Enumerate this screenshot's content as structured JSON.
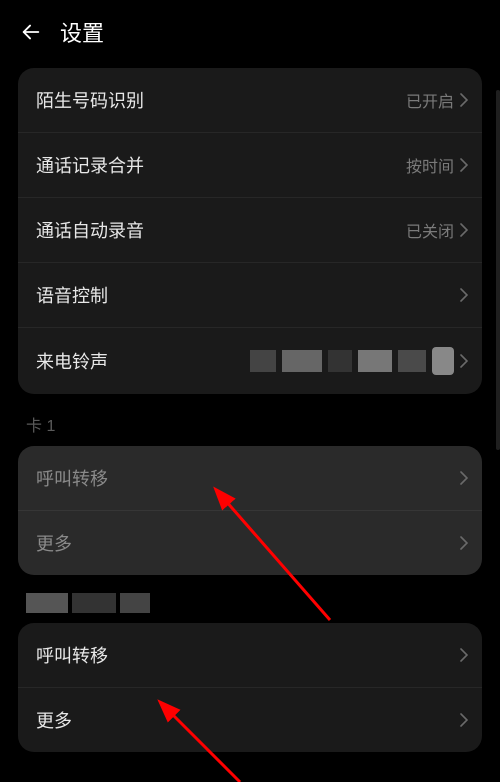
{
  "header": {
    "title": "设置"
  },
  "group1": {
    "items": [
      {
        "label": "陌生号码识别",
        "value": "已开启"
      },
      {
        "label": "通话记录合并",
        "value": "按时间"
      },
      {
        "label": "通话自动录音",
        "value": "已关闭"
      },
      {
        "label": "语音控制",
        "value": ""
      },
      {
        "label": "来电铃声",
        "value": ""
      }
    ]
  },
  "section1": {
    "label": "卡 1"
  },
  "group2": {
    "items": [
      {
        "label": "呼叫转移"
      },
      {
        "label": "更多"
      }
    ]
  },
  "group3": {
    "items": [
      {
        "label": "呼叫转移"
      },
      {
        "label": "更多"
      }
    ]
  }
}
